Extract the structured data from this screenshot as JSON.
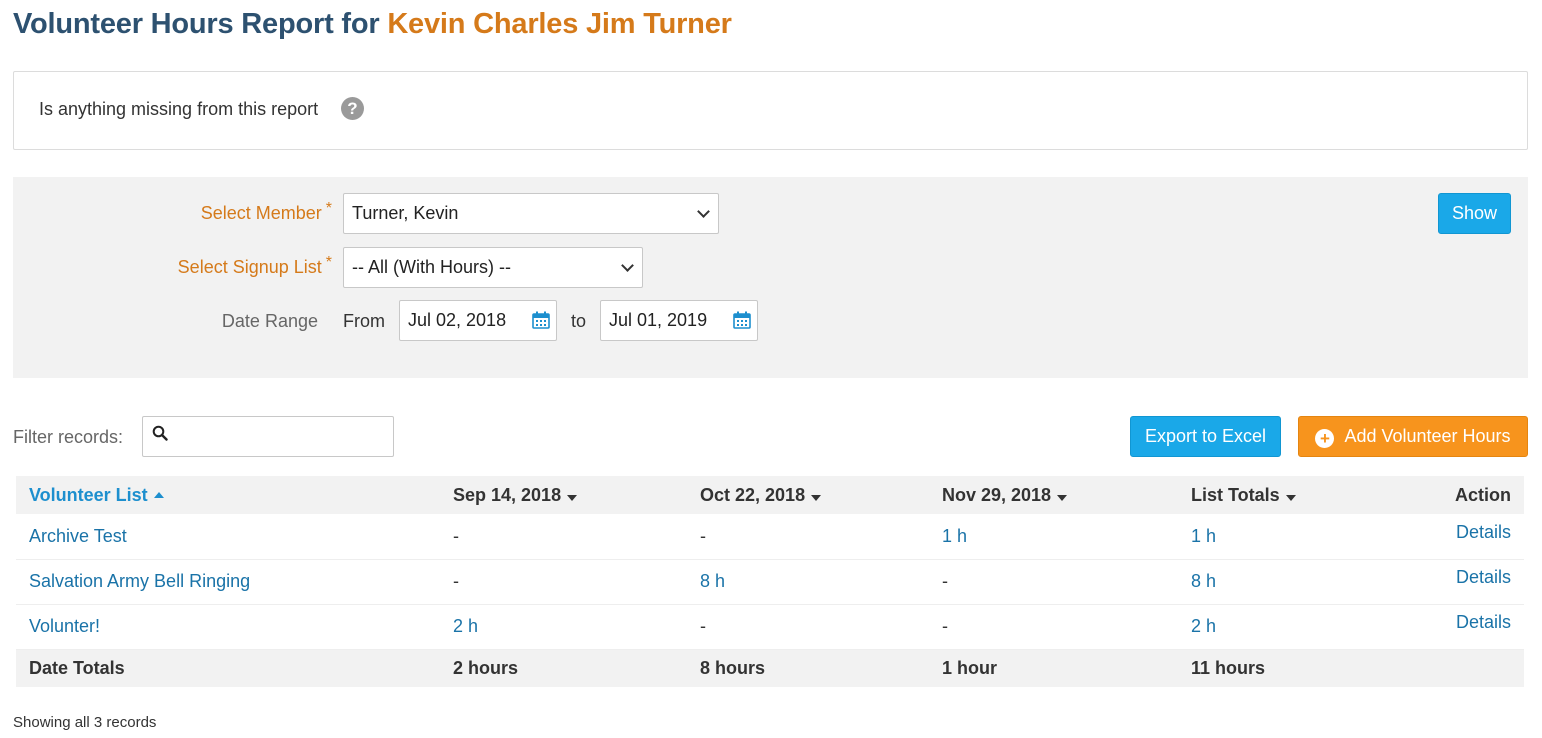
{
  "header": {
    "title_prefix": "Volunteer Hours Report for",
    "member_name": "Kevin Charles Jim Turner"
  },
  "notice": {
    "text": "Is anything missing from this report"
  },
  "filters": {
    "member_label": "Select Member",
    "member_value": "Turner, Kevin",
    "signup_label": "Select Signup List",
    "signup_value": "-- All (With Hours) --",
    "date_range_label": "Date Range",
    "from_label": "From",
    "from_value": "Jul 02, 2018",
    "to_label": "to",
    "to_value": "Jul 01, 2019",
    "show_button": "Show",
    "required_mark": "*"
  },
  "toolbar": {
    "filter_label": "Filter records:",
    "filter_value": "",
    "export_button": "Export to Excel",
    "add_button": "Add Volunteer Hours"
  },
  "table": {
    "headers": {
      "list": "Volunteer List",
      "d1": "Sep 14, 2018",
      "d2": "Oct 22, 2018",
      "d3": "Nov 29, 2018",
      "totals": "List Totals",
      "action": "Action"
    },
    "rows": [
      {
        "list": "Archive Test",
        "d1": "-",
        "d2": "-",
        "d3": "1 h",
        "total": "1 h",
        "action": "Details"
      },
      {
        "list": "Salvation Army Bell Ringing",
        "d1": "-",
        "d2": "8 h",
        "d3": "-",
        "total": "8 h",
        "action": "Details"
      },
      {
        "list": "Volunter!",
        "d1": "2 h",
        "d2": "-",
        "d3": "-",
        "total": "2 h",
        "action": "Details"
      }
    ],
    "totals": {
      "label": "Date Totals",
      "d1": "2 hours",
      "d2": "8 hours",
      "d3": "1 hour",
      "total": "11 hours"
    }
  },
  "footer": {
    "showing": "Showing all 3 records"
  },
  "colors": {
    "title": "#2d5170",
    "accent_orange": "#d57a1a",
    "button_blue": "#1aa8e8",
    "button_orange": "#f7941d",
    "link": "#1a73a8"
  }
}
